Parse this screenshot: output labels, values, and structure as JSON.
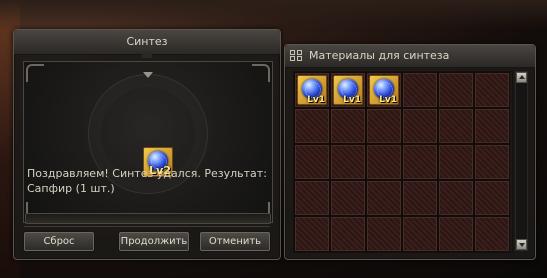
{
  "synthesis": {
    "title": "Синтез",
    "result_item": {
      "icon": "sapphire-gem-icon",
      "level": "Lv2"
    },
    "message_line1": "Поздравляем! Синтез удался. Результат:",
    "message_line2": "Сапфир (1 шт.)",
    "buttons": {
      "reset": "Сброс",
      "continue": "Продолжить",
      "cancel": "Отменить"
    }
  },
  "materials": {
    "title": "Материалы для синтеза",
    "items": [
      {
        "icon": "sapphire-gem-icon",
        "level": "Lv1"
      },
      {
        "icon": "sapphire-gem-icon",
        "level": "Lv1"
      },
      {
        "icon": "sapphire-gem-icon",
        "level": "Lv1"
      }
    ]
  },
  "colors": {
    "window_bg": "#1c1a18",
    "slot_bg": "#3a1f1c",
    "gem_blue": "#2c49d6",
    "item_frame_gold": "#f2c84c"
  }
}
